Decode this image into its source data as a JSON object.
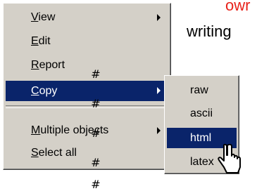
{
  "background": {
    "red_text": "owr",
    "black_text": "writing"
  },
  "main_menu": {
    "items": [
      {
        "label": "View",
        "mnemonic": "V",
        "rest": "iew",
        "submenu": true
      },
      {
        "label": "Edit",
        "mnemonic": "E",
        "rest": "dit",
        "submenu": false
      },
      {
        "label": "Report",
        "mnemonic": "R",
        "rest": "eport",
        "submenu": false
      },
      {
        "label": "Copy",
        "mnemonic": "C",
        "rest": "opy",
        "submenu": true,
        "selected": true
      },
      {
        "label": "Multiple objects",
        "mnemonic": "M",
        "rest": "ultiple objects",
        "submenu": true
      },
      {
        "label": "Select all",
        "mnemonic": "S",
        "rest": "elect all",
        "submenu": false
      }
    ]
  },
  "sub_menu": {
    "items": [
      {
        "label": "raw"
      },
      {
        "label": "ascii"
      },
      {
        "label": "html",
        "selected": true
      },
      {
        "label": "latex"
      }
    ]
  },
  "overlay": {
    "hash_glyph": "#"
  },
  "colors": {
    "menu_face": "#d4d0c8",
    "selection": "#0a246a",
    "red_text": "#e8231b"
  }
}
